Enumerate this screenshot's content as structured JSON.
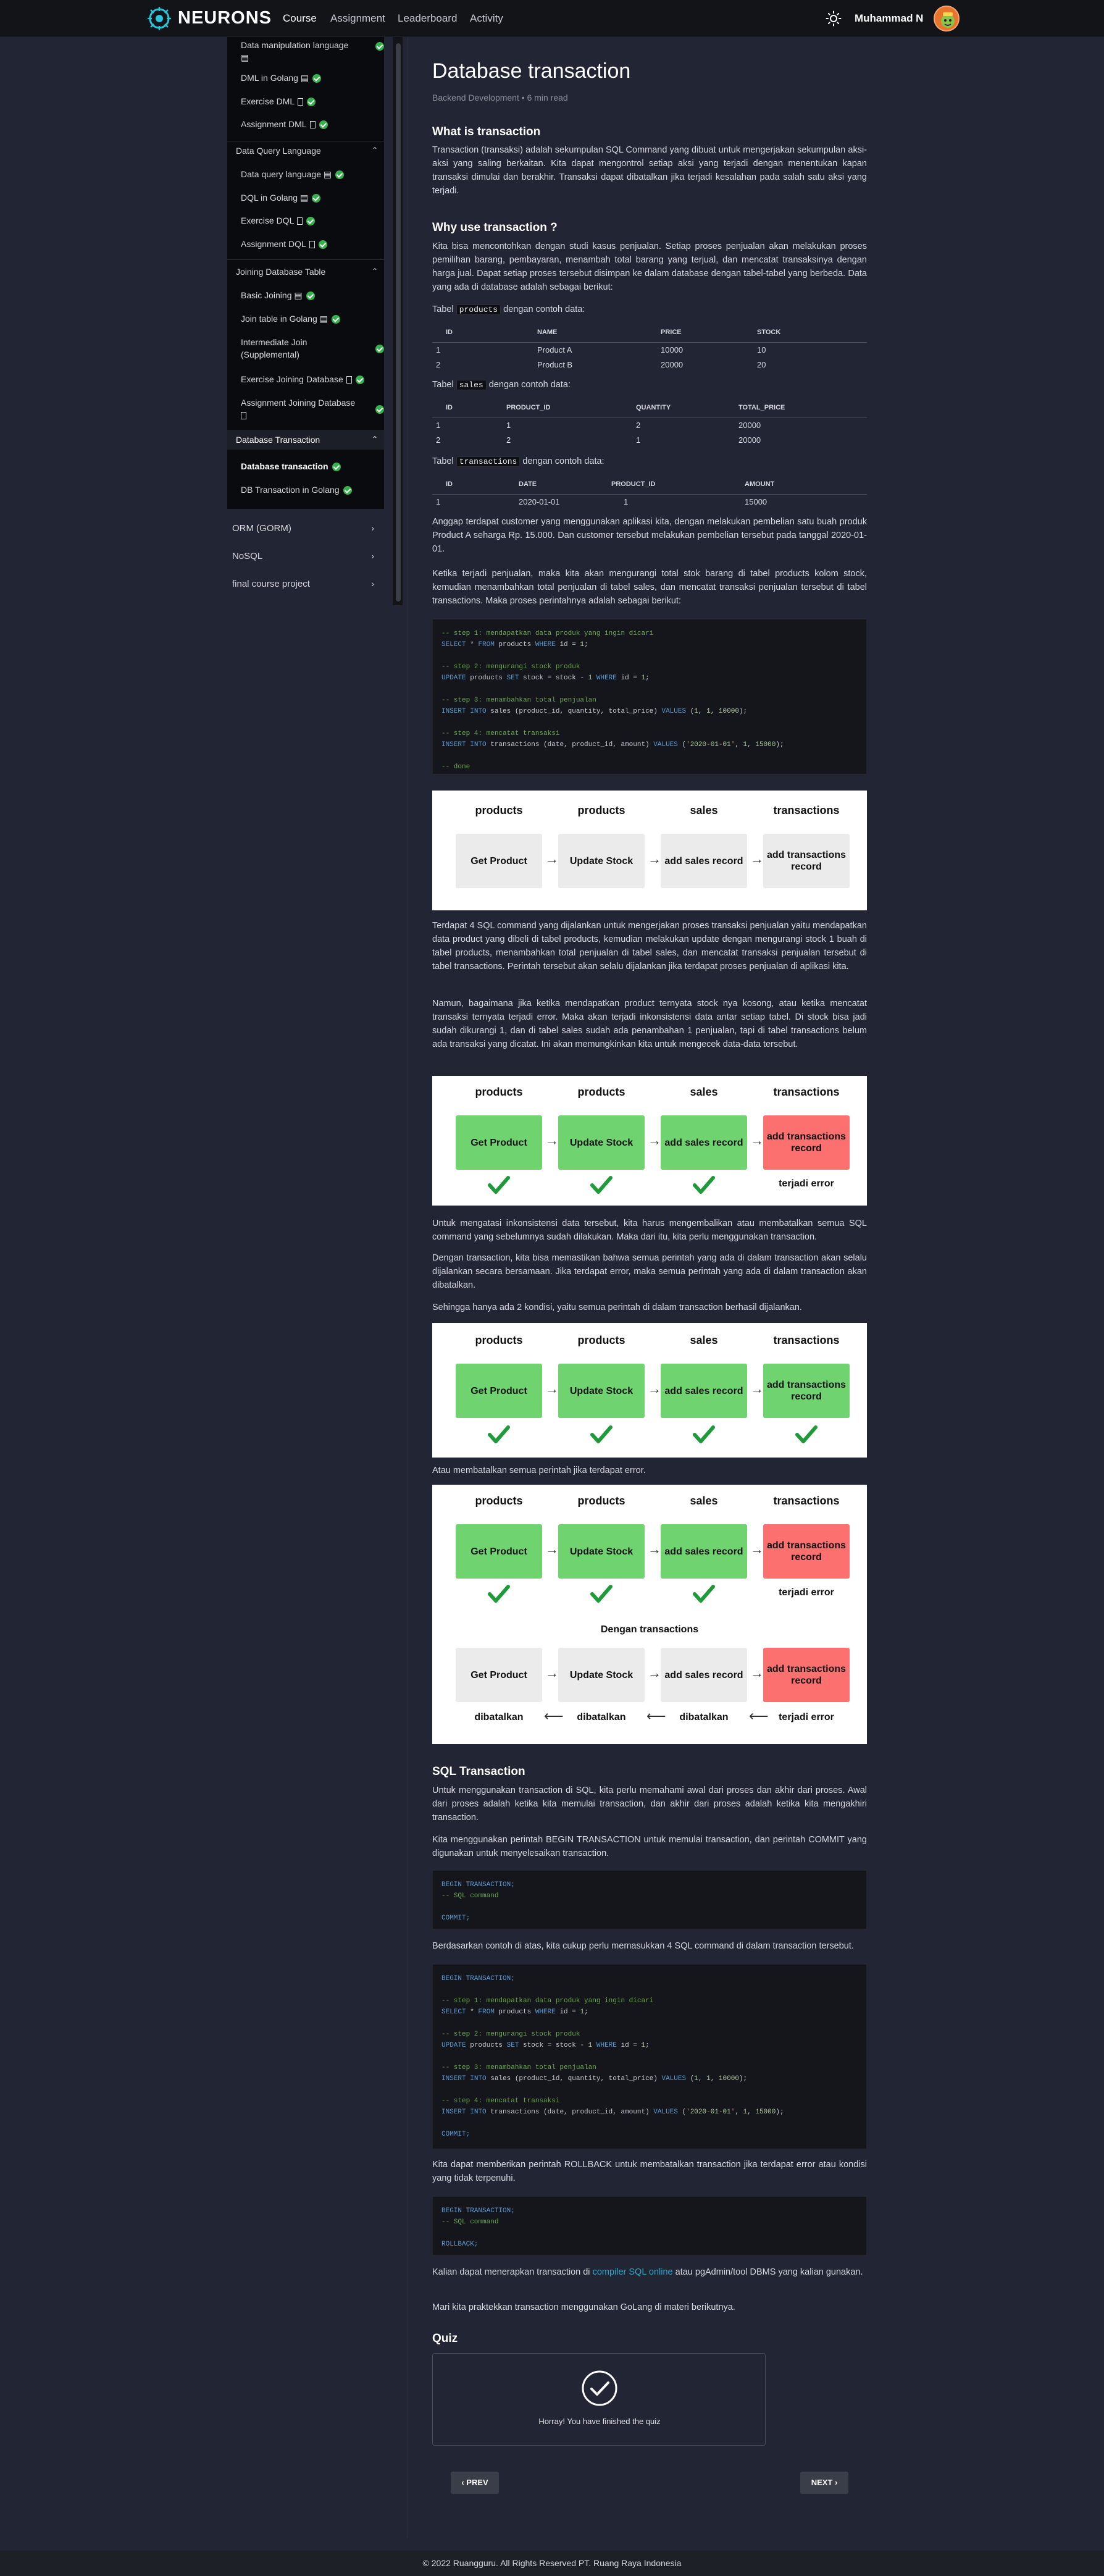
{
  "header": {
    "brand": "NEURONS",
    "nav": [
      "Course",
      "Assignment",
      "Leaderboard",
      "Activity"
    ],
    "username": "Muhammad N"
  },
  "sidebar": {
    "items": [
      {
        "label": "Data manipulation language",
        "icon": "video-icon"
      },
      {
        "label": "DML in Golang",
        "icon": "video-icon"
      },
      {
        "label": "Exercise DML",
        "icon": "doc-icon"
      },
      {
        "label": "Assignment DML",
        "icon": "doc-icon"
      },
      {
        "label": "Data Query Language",
        "section": true
      },
      {
        "label": "Data query language",
        "icon": "video-icon"
      },
      {
        "label": "DQL in Golang",
        "icon": "video-icon"
      },
      {
        "label": "Exercise DQL",
        "icon": "doc-icon"
      },
      {
        "label": "Assignment DQL",
        "icon": "doc-icon"
      },
      {
        "label": "Joining Database Table",
        "section": true
      },
      {
        "label": "Basic Joining",
        "icon": "video-icon"
      },
      {
        "label": "Join table in Golang",
        "icon": "video-icon"
      },
      {
        "label": "Intermediate Join (Supplemental)"
      },
      {
        "label": "Exercise Joining Database",
        "icon": "doc-icon"
      },
      {
        "label": "Assignment Joining Database",
        "icon": "doc-icon"
      },
      {
        "label": "Database Transaction",
        "section": true
      },
      {
        "label": "Database transaction"
      },
      {
        "label": "DB Transaction in Golang"
      }
    ],
    "outside": [
      "ORM (GORM)",
      "NoSQL",
      "final course project"
    ]
  },
  "article": {
    "title": "Database transaction",
    "category": "Backend Development",
    "readtime": "6 min read",
    "h_what": "What is transaction",
    "p_what": "Transaction (transaksi) adalah sekumpulan SQL Command yang dibuat untuk mengerjakan sekumpulan aksi-aksi yang saling berkaitan. Kita dapat mengontrol setiap aksi yang terjadi dengan menentukan kapan transaksi dimulai dan berakhir. Transaksi dapat dibatalkan jika terjadi kesalahan pada salah satu aksi yang terjadi.",
    "h_why": "Why use transaction ?",
    "p_why": "Kita bisa mencontohkan dengan studi kasus penjualan. Setiap proses penjualan akan melakukan proses pemilihan barang, pembayaran, menambah total barang yang terjual, dan mencatat transaksinya dengan harga jual. Dapat setiap proses tersebut disimpan ke dalam database dengan tabel-tabel yang berbeda. Data yang ada di database adalah sebagai berikut:",
    "tbl_products_pre": "Tabel",
    "tbl_products_code": "products",
    "tbl_products_post": "dengan contoh data:",
    "products_cols": [
      "ID",
      "NAME",
      "PRICE",
      "STOCK"
    ],
    "products_rows": [
      [
        "1",
        "Product A",
        "10000",
        "10"
      ],
      [
        "2",
        "Product B",
        "20000",
        "20"
      ]
    ],
    "tbl_sales_pre": "Tabel",
    "tbl_sales_code": "sales",
    "tbl_sales_post": "dengan contoh data:",
    "sales_cols": [
      "ID",
      "PRODUCT_ID",
      "QUANTITY",
      "TOTAL_PRICE"
    ],
    "sales_rows": [
      [
        "1",
        "1",
        "2",
        "20000"
      ],
      [
        "2",
        "2",
        "1",
        "20000"
      ]
    ],
    "tbl_tx_pre": "Tabel",
    "tbl_tx_code": "transactions",
    "tbl_tx_post": "dengan contoh data:",
    "tx_cols": [
      "ID",
      "DATE",
      "PRODUCT_ID",
      "AMOUNT"
    ],
    "tx_rows": [
      [
        "1",
        "2020-01-01",
        "1",
        "15000"
      ]
    ],
    "p_assume": "Anggap terdapat customer yang menggunakan aplikasi kita, dengan melakukan pembelian satu buah produk Product A seharga Rp. 15.000. Dan customer tersebut melakukan pembelian tersebut pada tanggal 2020-01-01.",
    "p_when": "Ketika terjadi penjualan, maka kita akan mengurangi total stok barang di tabel products kolom stock, kemudian menambahkan total penjualan di tabel sales, dan mencatat transaksi penjualan tersebut di tabel transactions. Maka proses perintahnya adalah sebagai berikut:",
    "p_four": "Terdapat 4 SQL command yang dijalankan untuk mengerjakan proses transaksi penjualan yaitu mendapatkan data product yang dibeli di tabel products, kemudian melakukan update dengan mengurangi stock 1 buah di tabel products, menambahkan total penjualan di tabel sales, dan mencatat transaksi penjualan tersebut di tabel transactions. Perintah tersebut akan selalu dijalankan jika terdapat proses penjualan di aplikasi kita.",
    "p_but": "Namun, bagaimana jika ketika mendapatkan product ternyata stock nya kosong, atau ketika mencatat transaksi ternyata terjadi error. Maka akan terjadi inkonsistensi data antar setiap tabel. Di stock bisa jadi sudah dikurangi 1, dan di tabel sales sudah ada penambahan 1 penjualan, tapi di tabel transactions belum ada transaksi yang dicatat. Ini akan memungkinkan kita untuk mengecek data-data tersebut.",
    "p_overcome": "Untuk mengatasi inkonsistensi data tersebut, kita harus mengembalikan atau membatalkan semua SQL command yang sebelumnya sudah dilakukan. Maka dari itu, kita perlu menggunakan transaction.",
    "p_with": "Dengan transaction, kita bisa memastikan bahwa semua perintah yang ada di dalam transaction akan selalu dijalankan secara bersamaan. Jika terdapat error, maka semua perintah yang ada di dalam transaction akan dibatalkan.",
    "p_two": "Sehingga hanya ada 2 kondisi, yaitu semua perintah di dalam transaction berhasil dijalankan.",
    "p_or": "Atau membatalkan semua perintah jika terdapat error.",
    "h_sql": "SQL Transaction",
    "p_sql": "Untuk menggunakan transaction di SQL, kita perlu memahami awal dari proses dan akhir dari proses. Awal dari proses adalah ketika kita memulai transaction, dan akhir dari proses adalah ketika kita mengakhiri transaction.",
    "p_begin": "Kita menggunakan perintah BEGIN TRANSACTION untuk memulai transaction, dan perintah COMMIT yang digunakan untuk menyelesaikan transaction.",
    "p_based": "Berdasarkan contoh di atas, kita cukup perlu memasukkan 4 SQL command di dalam transaction tersebut.",
    "p_rollback": "Kita dapat memberikan perintah ROLLBACK untuk membatalkan transaction jika terdapat error atau kondisi yang tidak terpenuhi.",
    "p_apply_pre": "Kalian dapat menerapkan transaction di",
    "p_apply_link": "compiler SQL online",
    "p_apply_post": "atau pgAdmin/tool DBMS yang kalian gunakan.",
    "p_practice": "Mari kita praktekkan transaction menggunakan GoLang di materi berikutnya.",
    "h_quiz": "Quiz",
    "quiz_done": "Horray! You have finished the quiz"
  },
  "code": {
    "c1": [
      [
        "cm",
        "-- step 1: mendapatkan data produk yang ingin dicari"
      ],
      [
        "sql",
        "SELECT * FROM products WHERE id = 1;"
      ],
      [
        "",
        ""
      ],
      [
        "cm",
        "-- step 2: mengurangi stock produk"
      ],
      [
        "sql",
        "UPDATE products SET stock = stock - 1 WHERE id = 1;"
      ],
      [
        "",
        ""
      ],
      [
        "cm",
        "-- step 3: menambahkan total penjualan"
      ],
      [
        "sql",
        "INSERT INTO sales (product_id, quantity, total_price) VALUES (1, 1, 10000);"
      ],
      [
        "",
        ""
      ],
      [
        "cm",
        "-- step 4: mencatat transaksi"
      ],
      [
        "sql",
        "INSERT INTO transactions (date, product_id, amount) VALUES ('2020-01-01', 1, 15000);"
      ],
      [
        "",
        ""
      ],
      [
        "cm",
        "-- done"
      ]
    ],
    "c2": [
      [
        "kw",
        "BEGIN TRANSACTION;"
      ],
      [
        "cm",
        "-- SQL command"
      ],
      [
        "",
        ""
      ],
      [
        "kw",
        "COMMIT;"
      ]
    ],
    "c3": [
      [
        "kw",
        "BEGIN TRANSACTION;"
      ],
      [
        "",
        ""
      ],
      [
        "cm",
        "-- step 1: mendapatkan data produk yang ingin dicari"
      ],
      [
        "sql",
        "SELECT * FROM products WHERE id = 1;"
      ],
      [
        "",
        ""
      ],
      [
        "cm",
        "-- step 2: mengurangi stock produk"
      ],
      [
        "sql",
        "UPDATE products SET stock = stock - 1 WHERE id = 1;"
      ],
      [
        "",
        ""
      ],
      [
        "cm",
        "-- step 3: menambahkan total penjualan"
      ],
      [
        "sql",
        "INSERT INTO sales (product_id, quantity, total_price) VALUES (1, 1, 10000);"
      ],
      [
        "",
        ""
      ],
      [
        "cm",
        "-- step 4: mencatat transaksi"
      ],
      [
        "sql",
        "INSERT INTO transactions (date, product_id, amount) VALUES ('2020-01-01', 1, 15000);"
      ],
      [
        "",
        ""
      ],
      [
        "kw",
        "COMMIT;"
      ]
    ],
    "c4": [
      [
        "kw",
        "BEGIN TRANSACTION;"
      ],
      [
        "cm",
        "-- SQL command"
      ],
      [
        "",
        ""
      ],
      [
        "kw",
        "ROLLBACK;"
      ]
    ]
  },
  "diagram": {
    "cols": [
      "products",
      "products",
      "sales",
      "transactions"
    ],
    "boxes": [
      "Get Product",
      "Update Stock",
      "add sales record",
      "add transactions record"
    ],
    "error": "terjadi error",
    "with_tx": "Dengan transactions",
    "cancelled": "dibatalkan",
    "colors": {
      "green": "#6fd470",
      "red": "#fc7070",
      "gray": "#ebebeb"
    }
  },
  "pager": {
    "prev": "‹ PREV",
    "next": "NEXT ›"
  },
  "footer": "© 2022 Ruangguru. All Rights Reserved PT. Ruang Raya Indonesia"
}
